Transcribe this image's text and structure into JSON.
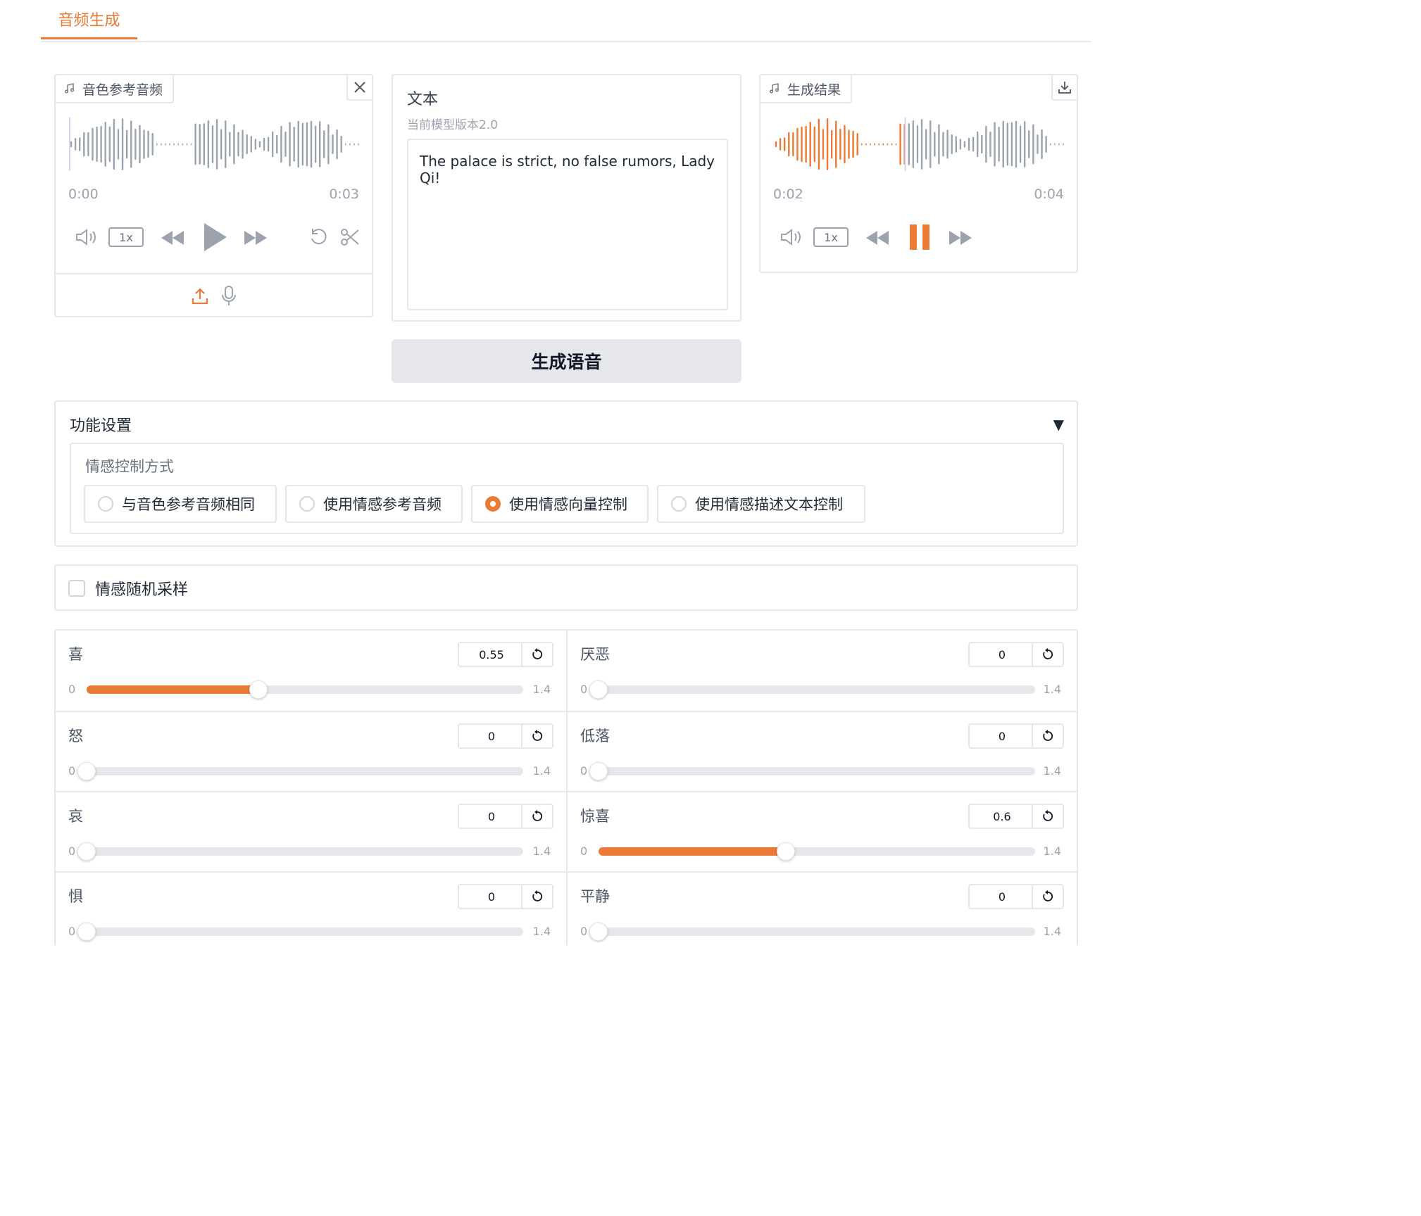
{
  "tabs": [
    {
      "label": "音频生成",
      "active": true
    }
  ],
  "reference_audio": {
    "label": "音色参考音频",
    "time_current": "0:00",
    "time_total": "0:03",
    "playback_rate": "1x",
    "state": "paused",
    "icons": [
      "music-note-icon",
      "close-icon",
      "volume-icon",
      "rewind-icon",
      "play-icon",
      "fast-forward-icon",
      "undo-icon",
      "scissors-icon",
      "upload-icon",
      "microphone-icon"
    ]
  },
  "text_input": {
    "label": "文本",
    "info": "当前模型版本2.0",
    "value": "The palace is strict, no false rumors, Lady Qi!"
  },
  "generated_audio": {
    "label": "生成结果",
    "time_current": "0:02",
    "time_total": "0:04",
    "playback_rate": "1x",
    "state": "playing",
    "progress": 0.45,
    "icons": [
      "music-note-icon",
      "download-icon",
      "volume-icon",
      "rewind-icon",
      "pause-icon",
      "fast-forward-icon"
    ]
  },
  "generate_button": {
    "label": "生成语音"
  },
  "settings": {
    "title": "功能设置",
    "expanded": true,
    "emotion_mode": {
      "label": "情感控制方式",
      "options": [
        {
          "label": "与音色参考音频相同",
          "selected": false
        },
        {
          "label": "使用情感参考音频",
          "selected": false
        },
        {
          "label": "使用情感向量控制",
          "selected": true
        },
        {
          "label": "使用情感描述文本控制",
          "selected": false
        }
      ]
    }
  },
  "random_sampling": {
    "label": "情感随机采样",
    "checked": false
  },
  "emotion_sliders": {
    "min_label": "0",
    "max_label": "1.4",
    "min": 0,
    "max": 1.4,
    "items": [
      {
        "label": "喜",
        "value": "0.55"
      },
      {
        "label": "厌恶",
        "value": "0"
      },
      {
        "label": "怒",
        "value": "0"
      },
      {
        "label": "低落",
        "value": "0"
      },
      {
        "label": "哀",
        "value": "0"
      },
      {
        "label": "惊喜",
        "value": "0.6"
      },
      {
        "label": "惧",
        "value": "0"
      },
      {
        "label": "平静",
        "value": "0"
      }
    ]
  },
  "colors": {
    "accent": "#ea7a35",
    "border": "#e5e7eb",
    "muted": "#9ca3af"
  }
}
